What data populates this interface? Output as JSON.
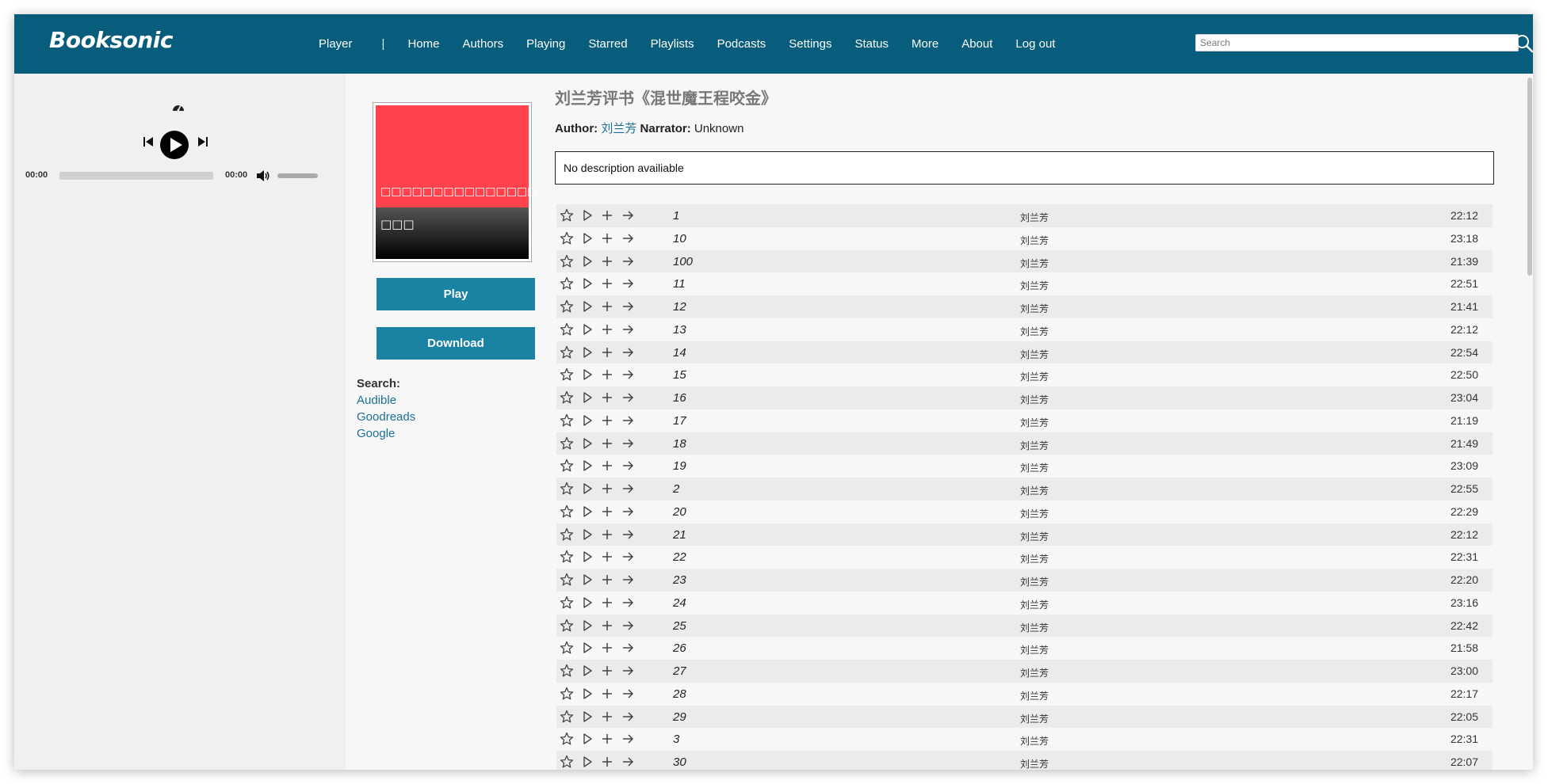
{
  "header": {
    "logo": "Booksonic",
    "nav": {
      "player": "Player",
      "separator": "|",
      "home": "Home",
      "authors": "Authors",
      "playing": "Playing",
      "starred": "Starred",
      "playlists": "Playlists",
      "podcasts": "Podcasts",
      "settings": "Settings",
      "status": "Status",
      "more": "More",
      "about": "About",
      "logout": "Log out"
    },
    "search_placeholder": "Search"
  },
  "player": {
    "current_time": "00:00",
    "duration": "00:00",
    "progress": 0
  },
  "cover": {
    "line1": "□□□□□□□□□□□□□□□",
    "line2": "□□□"
  },
  "actions": {
    "play_label": "Play",
    "download_label": "Download"
  },
  "search_links": {
    "label": "Search:",
    "audible": "Audible",
    "goodreads": "Goodreads",
    "google": "Google"
  },
  "book": {
    "title": "刘兰芳评书《混世魔王程咬金》",
    "author_label": "Author:",
    "author": "刘兰芳",
    "narrator_label": "Narrator:",
    "narrator": "Unknown",
    "description": "No description availiable"
  },
  "tracks": [
    {
      "title": "1",
      "artist": "刘兰芳",
      "duration": "22:12"
    },
    {
      "title": "10",
      "artist": "刘兰芳",
      "duration": "23:18"
    },
    {
      "title": "100",
      "artist": "刘兰芳",
      "duration": "21:39"
    },
    {
      "title": "11",
      "artist": "刘兰芳",
      "duration": "22:51"
    },
    {
      "title": "12",
      "artist": "刘兰芳",
      "duration": "21:41"
    },
    {
      "title": "13",
      "artist": "刘兰芳",
      "duration": "22:12"
    },
    {
      "title": "14",
      "artist": "刘兰芳",
      "duration": "22:54"
    },
    {
      "title": "15",
      "artist": "刘兰芳",
      "duration": "22:50"
    },
    {
      "title": "16",
      "artist": "刘兰芳",
      "duration": "23:04"
    },
    {
      "title": "17",
      "artist": "刘兰芳",
      "duration": "21:19"
    },
    {
      "title": "18",
      "artist": "刘兰芳",
      "duration": "21:49"
    },
    {
      "title": "19",
      "artist": "刘兰芳",
      "duration": "23:09"
    },
    {
      "title": "2",
      "artist": "刘兰芳",
      "duration": "22:55"
    },
    {
      "title": "20",
      "artist": "刘兰芳",
      "duration": "22:29"
    },
    {
      "title": "21",
      "artist": "刘兰芳",
      "duration": "22:12"
    },
    {
      "title": "22",
      "artist": "刘兰芳",
      "duration": "22:31"
    },
    {
      "title": "23",
      "artist": "刘兰芳",
      "duration": "22:20"
    },
    {
      "title": "24",
      "artist": "刘兰芳",
      "duration": "23:16"
    },
    {
      "title": "25",
      "artist": "刘兰芳",
      "duration": "22:42"
    },
    {
      "title": "26",
      "artist": "刘兰芳",
      "duration": "21:58"
    },
    {
      "title": "27",
      "artist": "刘兰芳",
      "duration": "23:00"
    },
    {
      "title": "28",
      "artist": "刘兰芳",
      "duration": "22:17"
    },
    {
      "title": "29",
      "artist": "刘兰芳",
      "duration": "22:05"
    },
    {
      "title": "3",
      "artist": "刘兰芳",
      "duration": "22:31"
    },
    {
      "title": "30",
      "artist": "刘兰芳",
      "duration": "22:07"
    }
  ],
  "colors": {
    "header_bg": "#075d7b",
    "button_bg": "#1a82a3",
    "link": "#1b6f98",
    "cover_red": "#ff424b"
  },
  "icons": {
    "track_actions": [
      "star-icon",
      "play-icon",
      "add-icon",
      "play-next-icon"
    ]
  }
}
